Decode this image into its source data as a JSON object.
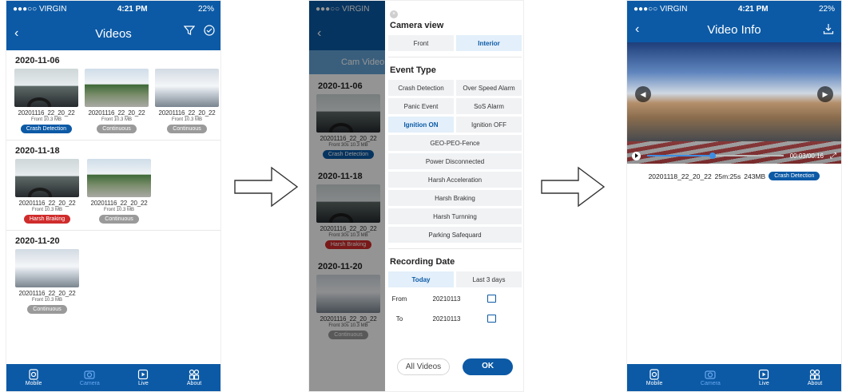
{
  "status": {
    "carrier": "●●●○○ VIRGIN",
    "time": "4:21 PM",
    "battery": "22%"
  },
  "videos_screen": {
    "title": "Videos",
    "groups": [
      {
        "date": "2020-11-06",
        "items": [
          {
            "name": "20201116_22_20_22",
            "size": "Front 10.3 MB",
            "tag": "Crash Detection",
            "tag_color": "#0c5aa6",
            "thumb": "dash"
          },
          {
            "name": "20201116_22_20_22",
            "size": "Front 10.3 MB",
            "tag": "Continuous",
            "tag_color": "#9a9a9a",
            "thumb": "road"
          },
          {
            "name": "20201116_22_20_22",
            "size": "Front 10.3 MB",
            "tag": "Continuous",
            "tag_color": "#9a9a9a",
            "thumb": "snow"
          }
        ]
      },
      {
        "date": "2020-11-18",
        "items": [
          {
            "name": "20201116_22_20_22",
            "size": "Front 10.3 MB",
            "tag": "Harsh Braking",
            "tag_color": "#d02c2c",
            "thumb": "dash"
          },
          {
            "name": "20201116_22_20_22",
            "size": "Front 10.3 MB",
            "tag": "Continuous",
            "tag_color": "#9a9a9a",
            "thumb": "road"
          }
        ]
      },
      {
        "date": "2020-11-20",
        "items": [
          {
            "name": "20201116_22_20_22",
            "size": "Front 10.3 MB",
            "tag": "Continuous",
            "tag_color": "#9a9a9a",
            "thumb": "snow"
          }
        ]
      }
    ]
  },
  "tabbar": [
    {
      "label": "Mobile",
      "icon": "mobile-icon"
    },
    {
      "label": "Camera",
      "icon": "camera-icon",
      "active": true
    },
    {
      "label": "Live",
      "icon": "play-icon"
    },
    {
      "label": "About",
      "icon": "grid-icon"
    }
  ],
  "filter_screen": {
    "underlay_title": "Cam Video",
    "underlay_dates": [
      "2020-11-06",
      "2020-11-18",
      "2020-11-20"
    ],
    "underlay_items": [
      {
        "name": "20201116_22_20_22",
        "size": "Front 30s 10.3 MB",
        "tag": "Crash Detection",
        "tag_color": "#0c5aa6"
      },
      {
        "name": "20201116_22_20_22",
        "size": "Front 30s 10.3 MB",
        "tag": "Harsh Braking",
        "tag_color": "#d02c2c"
      },
      {
        "name": "20201116_22_20_22",
        "size": "Front 30s 10.3 MB",
        "tag": "Continuous",
        "tag_color": "#9a9a9a"
      }
    ],
    "camera_view_title": "Camera view",
    "camera_views": [
      {
        "label": "Front",
        "selected": false
      },
      {
        "label": "Interior",
        "selected": true
      }
    ],
    "event_type_title": "Event Type",
    "event_pairs": [
      {
        "label": "Crash Detection",
        "selected": false
      },
      {
        "label": "Over Speed Alarm",
        "selected": false
      },
      {
        "label": "Panic Event",
        "selected": false
      },
      {
        "label": "SoS Alarm",
        "selected": false
      },
      {
        "label": "Ignition ON",
        "selected": true
      },
      {
        "label": "Ignition OFF",
        "selected": false
      }
    ],
    "event_full": [
      "GEO-PEO-Fence",
      "Power Disconnected",
      "Harsh Acceleration",
      "Harsh Braking",
      "Harsh Turnning",
      "Parking Safequard"
    ],
    "recording_date_title": "Recording Date",
    "date_options": [
      {
        "label": "Today",
        "selected": true
      },
      {
        "label": "Last 3 days",
        "selected": false
      }
    ],
    "from_label": "From",
    "from_value": "20210113",
    "to_label": "To",
    "to_value": "20210113",
    "all_videos_label": "All Videos",
    "ok_label": "OK"
  },
  "video_info_screen": {
    "title": "Video Info",
    "time_display": "00:03/00:16",
    "progress": 0.48,
    "filename": "20201118_22_20_22",
    "duration": "25m:25s",
    "size": "243MB",
    "tag": "Crash Detection"
  }
}
